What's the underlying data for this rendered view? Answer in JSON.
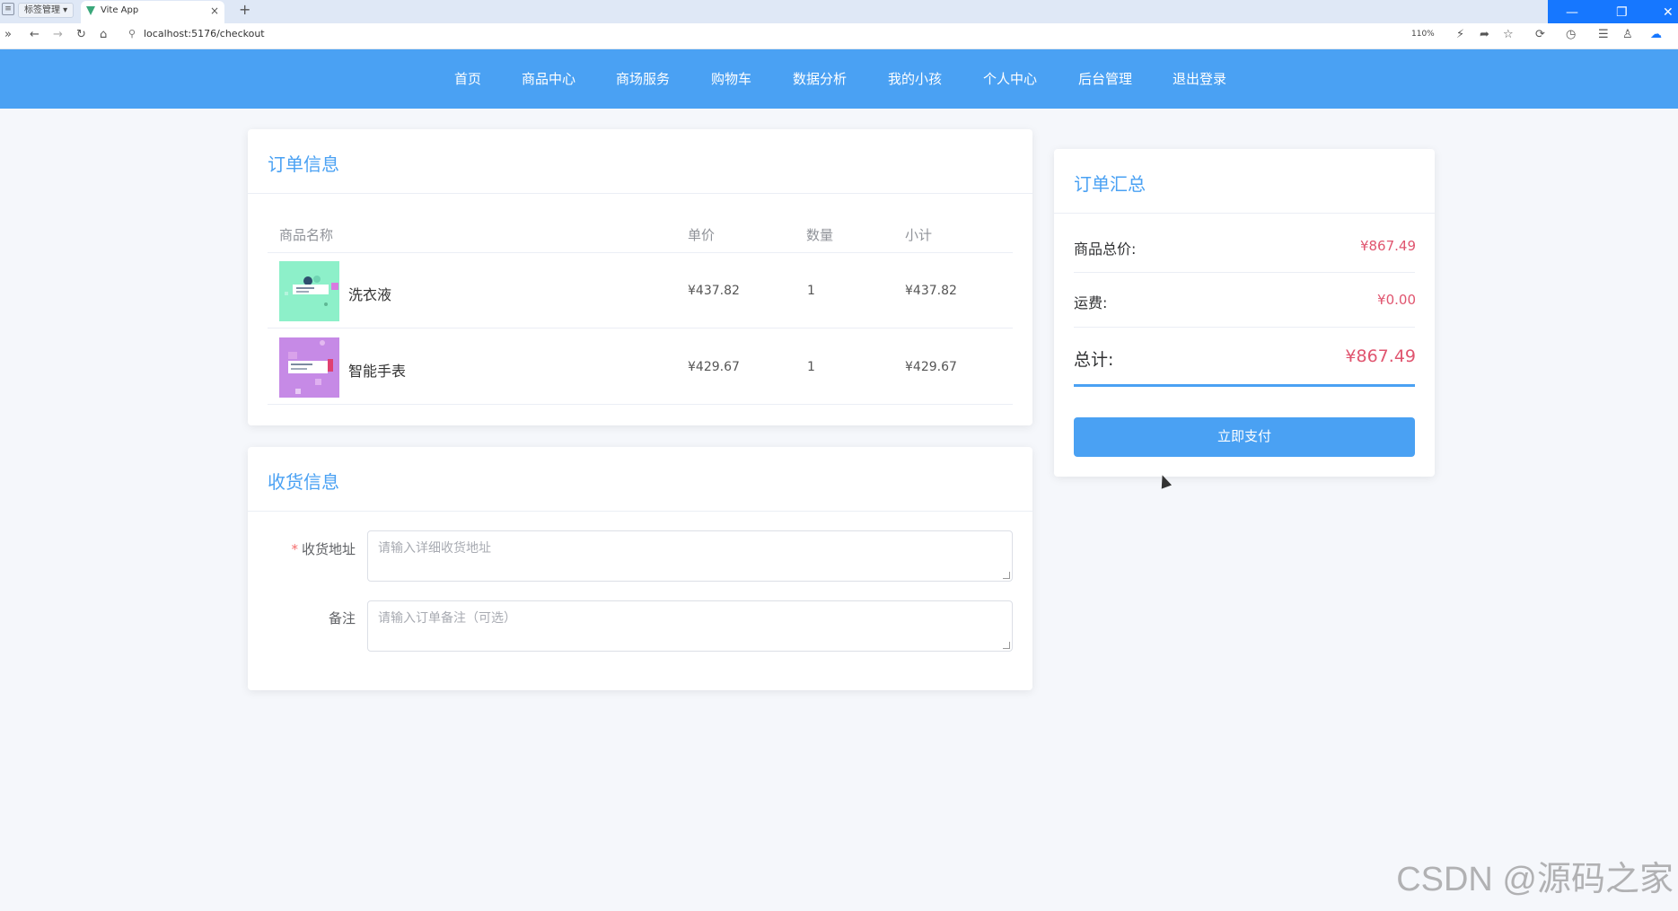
{
  "browser": {
    "tab_group_label": "标签管理",
    "active_tab_title": "Vite App",
    "url": "localhost:5176/checkout",
    "zoom": "110%"
  },
  "nav": {
    "items": [
      "首页",
      "商品中心",
      "商场服务",
      "购物车",
      "数据分析",
      "我的小孩",
      "个人中心",
      "后台管理",
      "退出登录"
    ]
  },
  "order": {
    "title": "订单信息",
    "headers": {
      "name": "商品名称",
      "price": "单价",
      "qty": "数量",
      "subtotal": "小计"
    },
    "rows": [
      {
        "name": "洗衣液",
        "price": "¥437.82",
        "qty": "1",
        "subtotal": "¥437.82",
        "thumb_color": "#8df0c9"
      },
      {
        "name": "智能手表",
        "price": "¥429.67",
        "qty": "1",
        "subtotal": "¥429.67",
        "thumb_color": "#c68ae6"
      }
    ]
  },
  "shipping": {
    "title": "收货信息",
    "address_label": "收货地址",
    "address_placeholder": "请输入详细收货地址",
    "remark_label": "备注",
    "remark_placeholder": "请输入订单备注（可选）"
  },
  "summary": {
    "title": "订单汇总",
    "goods_total_label": "商品总价:",
    "goods_total_value": "¥867.49",
    "shipping_label": "运费:",
    "shipping_value": "¥0.00",
    "total_label": "总计:",
    "total_value": "¥867.49",
    "pay_button": "立即支付"
  },
  "watermark": "CSDN @源码之家",
  "colors": {
    "primary": "#4aa1f3",
    "price": "#e0556f"
  }
}
